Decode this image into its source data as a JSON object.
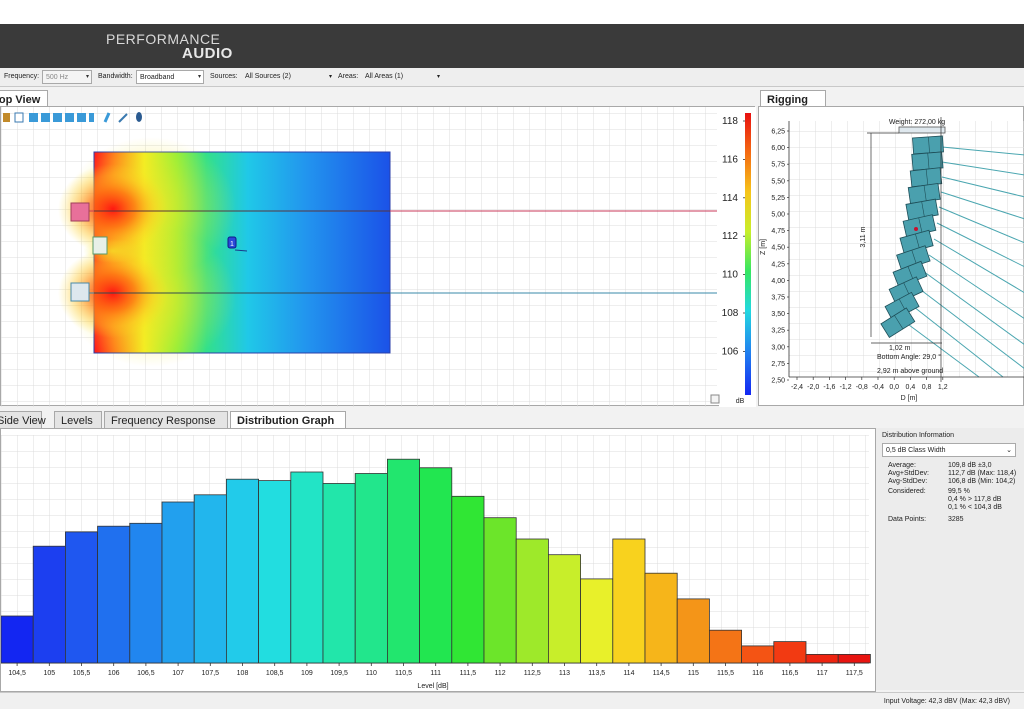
{
  "brand": {
    "line1": "PERFORMANCE",
    "line2": "AUDIO"
  },
  "toolbar": {
    "frequency_label": "Frequency:",
    "frequency_value": "500 Hz",
    "bandwidth_label": "Bandwidth:",
    "bandwidth_value": "Broadband",
    "sources_label": "Sources:",
    "sources_value": "All Sources (2)",
    "areas_label": "Areas:",
    "areas_value": "All Areas (1)"
  },
  "top_view": {
    "tab_label": "Top View",
    "source_marker_label": "1",
    "colorbar": {
      "ticks": [
        "118",
        "116",
        "114",
        "112",
        "110",
        "108",
        "106"
      ],
      "unit": "dB"
    }
  },
  "rigging": {
    "tab_label": "Rigging",
    "weight": "Weight: 272,00 kg",
    "height_dim": "3,11 m",
    "width_dim": "1,02 m",
    "bottom_angle": "Bottom Angle: 29,0 °",
    "above_ground": "2,92 m above ground",
    "z_axis_label": "Z [m]",
    "d_axis_label": "D [m]",
    "z_ticks": [
      "6,25",
      "6,00",
      "5,75",
      "5,50",
      "5,25",
      "5,00",
      "4,75",
      "4,50",
      "4,25",
      "4,00",
      "3,75",
      "3,50",
      "3,25",
      "3,00",
      "2,75",
      "2,50"
    ],
    "d_ticks": [
      "-2,4",
      "-2,0",
      "-1,6",
      "-1,2",
      "-0,8",
      "-0,4",
      "0,0",
      "0,4",
      "0,8",
      "1,2"
    ]
  },
  "bottom_tabs": [
    {
      "label": "Side View",
      "active": false
    },
    {
      "label": "Levels",
      "active": false
    },
    {
      "label": "Frequency Response",
      "active": false
    },
    {
      "label": "Distribution Graph",
      "active": true
    }
  ],
  "distribution_info": {
    "title": "Distribution Information",
    "class_width": "0,5 dB Class Width",
    "rows": [
      {
        "label": "Average:",
        "value": "109,8 dB ±3,0"
      },
      {
        "label": "Avg+StdDev:",
        "value": "112,7 dB (Max: 118,4)"
      },
      {
        "label": "Avg-StdDev:",
        "value": "106,8 dB (Min: 104,2)"
      },
      {
        "label": "Considered:",
        "value": "99,5 %"
      },
      {
        "label": "",
        "value": "0,4 % > 117,8 dB"
      },
      {
        "label": "",
        "value": "0,1 % < 104,3 dB"
      },
      {
        "label": "Data Points:",
        "value": "3285"
      }
    ]
  },
  "status": {
    "input_voltage": "Input Voltage: 42,3 dBV (Max: 42,3 dBV)"
  },
  "chart_data": {
    "type": "bar",
    "xlabel": "Level [dB]",
    "ylabel": "",
    "categories": [
      "104,5",
      "105",
      "105,5",
      "106",
      "106,5",
      "107",
      "107,5",
      "108",
      "108,5",
      "109",
      "109,5",
      "110",
      "110,5",
      "111",
      "111,5",
      "112",
      "112,5",
      "113",
      "113,5",
      "114",
      "114,5",
      "115",
      "115,5",
      "116",
      "116,5",
      "117",
      "117,5"
    ],
    "values": [
      33,
      82,
      92,
      96,
      98,
      113,
      118,
      129,
      128,
      134,
      126,
      133,
      143,
      137,
      117,
      102,
      87,
      76,
      59,
      87,
      63,
      45,
      23,
      12,
      15,
      6,
      6
    ],
    "value_units": "relative frequency (unlabeled axis)",
    "bar_colors": [
      "#1326f2",
      "#1c3ff0",
      "#1f57f0",
      "#2070ef",
      "#2186ef",
      "#22a0ee",
      "#22b6ed",
      "#22cbea",
      "#22dde0",
      "#22e4c6",
      "#22e6aa",
      "#22e68c",
      "#22e66e",
      "#22e650",
      "#30e634",
      "#6ce52a",
      "#9ee92a",
      "#c8ee2a",
      "#e8f02a",
      "#f8d21e",
      "#f6b51a",
      "#f49518",
      "#f47416",
      "#f45414",
      "#f23a12",
      "#ee2410",
      "#e81410"
    ],
    "grid": true
  }
}
